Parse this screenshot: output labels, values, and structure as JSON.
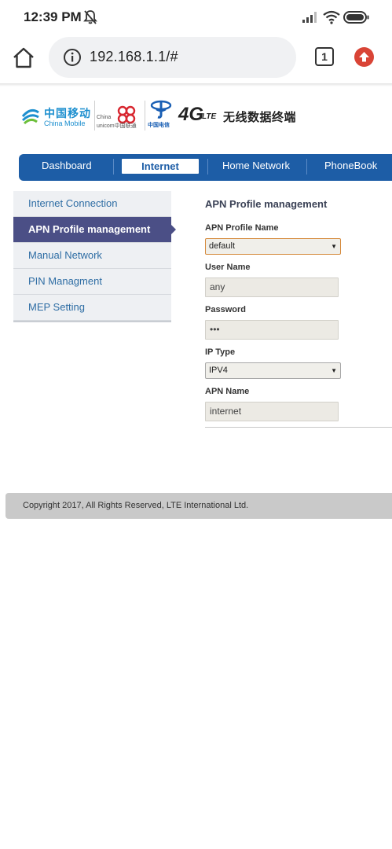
{
  "status_bar": {
    "time": "12:39 PM"
  },
  "browser": {
    "url": "192.168.1.1/#",
    "tab_count": "1"
  },
  "logos": {
    "china_mobile_cn": "中国移动",
    "china_mobile_en": "China Mobile",
    "china_unicom_en1": "China",
    "china_unicom_en2": "unicom中国联通",
    "china_telecom_cn": "中国电信",
    "lte_4g": "4G",
    "lte_sup": "LTE",
    "lte_cn": "无线数据终端"
  },
  "nav": {
    "items": [
      {
        "label": "Dashboard"
      },
      {
        "label": "Internet",
        "active": true
      },
      {
        "label": "Home Network"
      },
      {
        "label": "PhoneBook"
      }
    ]
  },
  "sidebar": {
    "items": [
      {
        "label": "Internet Connection"
      },
      {
        "label": "APN Profile management",
        "active": true
      },
      {
        "label": "Manual Network"
      },
      {
        "label": "PIN Managment"
      },
      {
        "label": "MEP Setting"
      }
    ]
  },
  "panel": {
    "title": "APN Profile management",
    "fields": [
      {
        "label": "APN Profile Name",
        "type": "select",
        "value": "default"
      },
      {
        "label": "User Name",
        "type": "input",
        "value": "any"
      },
      {
        "label": "Password",
        "type": "input",
        "value": "•••"
      },
      {
        "label": "IP Type",
        "type": "select",
        "value": "IPV4"
      },
      {
        "label": "APN Name",
        "type": "input",
        "value": "internet"
      }
    ]
  },
  "footer": {
    "text": "Copyright 2017, All Rights Reserved, LTE International Ltd."
  },
  "colors": {
    "nav_blue": "#1d5da6",
    "sidebar_active": "#4b4f86",
    "sidebar_text": "#2e6da4",
    "update_red": "#d94436"
  }
}
